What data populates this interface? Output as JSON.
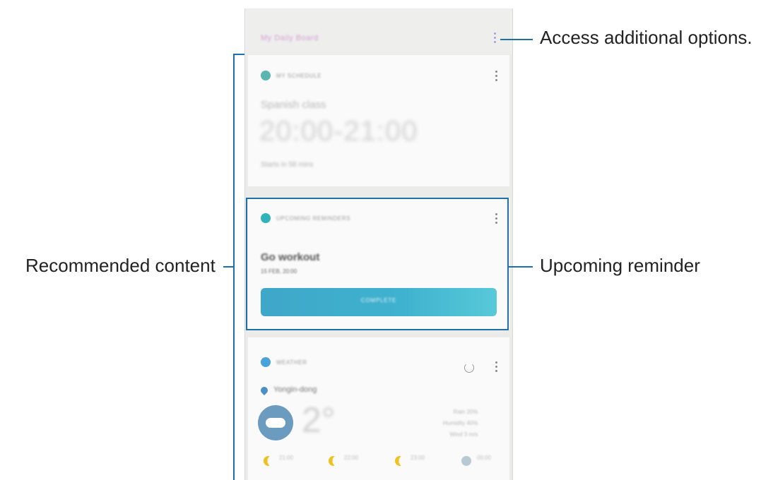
{
  "app": {
    "header_title": "My Daily Board"
  },
  "cards": {
    "schedule": {
      "header": "MY SCHEDULE",
      "event": "Spanish class",
      "time": "20:00-21:00",
      "subtext": "Starts in 58 mins"
    },
    "reminder": {
      "header": "UPCOMING REMINDERS",
      "title": "Go workout",
      "datetime": "15 FEB, 20:00",
      "action_label": "COMPLETE"
    },
    "weather": {
      "header": "WEATHER",
      "location": "Yongin-dong",
      "temperature": "2°",
      "details": [
        "Rain 20%",
        "Humidity 40%",
        "Wind 3 m/s"
      ],
      "forecast": [
        {
          "icon": "moon-cloud-icon",
          "text": "21:00"
        },
        {
          "icon": "moon-icon",
          "text": "22:00"
        },
        {
          "icon": "moon-icon",
          "text": "23:00"
        },
        {
          "icon": "cloud-icon",
          "text": "00:00"
        }
      ]
    }
  },
  "annotations": {
    "options": "Access additional options.",
    "recommended": "Recommended content",
    "reminder": "Upcoming reminder"
  },
  "colors": {
    "callout": "#1f6fa8",
    "reminder_button": "#3fa7c9",
    "schedule_icon": "#5bb5b0",
    "reminder_icon": "#2fb3b9",
    "weather_icon": "#4aa3d8"
  }
}
